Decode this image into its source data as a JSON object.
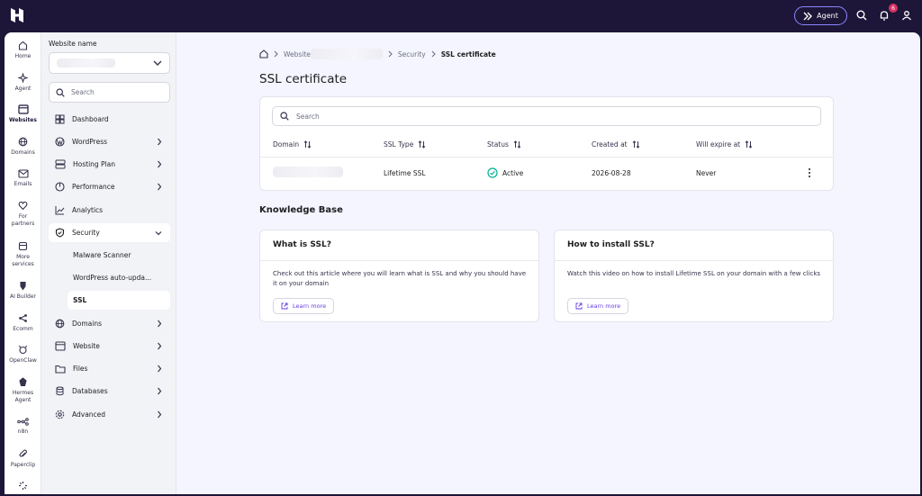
{
  "topbar": {
    "agent_label": "Agent",
    "notification_count": "6"
  },
  "rail": [
    {
      "label": "Home",
      "icon": "home-icon"
    },
    {
      "label": "Agent",
      "icon": "agent-icon"
    },
    {
      "label": "Websites",
      "icon": "websites-icon",
      "active": true
    },
    {
      "label": "Domains",
      "icon": "globe-icon"
    },
    {
      "label": "Emails",
      "icon": "mail-icon"
    },
    {
      "label": "For partners",
      "icon": "heart-icon"
    },
    {
      "label": "More services",
      "icon": "box-icon"
    },
    {
      "label": "AI Builder",
      "icon": "ai-builder-icon"
    },
    {
      "label": "Ecomm",
      "icon": "share-icon"
    },
    {
      "label": "OpenClaw",
      "icon": "claw-icon"
    },
    {
      "label": "Hermes Agent",
      "icon": "hermes-icon"
    },
    {
      "label": "n8n",
      "icon": "n8n-icon"
    },
    {
      "label": "Paperclip",
      "icon": "paperclip-icon"
    }
  ],
  "sidebar": {
    "title": "Website name",
    "search_placeholder": "Search",
    "items": [
      {
        "label": "Dashboard",
        "icon": "dashboard-icon"
      },
      {
        "label": "WordPress",
        "icon": "wordpress-icon"
      },
      {
        "label": "Hosting Plan",
        "icon": "server-icon"
      },
      {
        "label": "Performance",
        "icon": "gauge-icon"
      },
      {
        "label": "Analytics",
        "icon": "chart-line-icon"
      },
      {
        "label": "Security",
        "icon": "shield-icon"
      },
      {
        "label": "Domains",
        "icon": "globe-icon"
      },
      {
        "label": "Website",
        "icon": "browser-icon"
      },
      {
        "label": "Files",
        "icon": "folder-icon"
      },
      {
        "label": "Databases",
        "icon": "database-icon"
      },
      {
        "label": "Advanced",
        "icon": "gear-icon"
      }
    ],
    "security_sub": [
      {
        "label": "Malware Scanner"
      },
      {
        "label": "WordPress auto-upda..."
      },
      {
        "label": "SSL"
      }
    ]
  },
  "breadcrumb": {
    "websites": "Website",
    "security": "Security",
    "current": "SSL certificate"
  },
  "page_title": "SSL certificate",
  "table": {
    "search_placeholder": "Search",
    "columns": [
      "Domain",
      "SSL Type",
      "Status",
      "Created at",
      "Will expire at"
    ],
    "rows": [
      {
        "ssl_type": "Lifetime SSL",
        "status": "Active",
        "created_at": "2026-08-28",
        "expires": "Never"
      }
    ]
  },
  "knowledge_base": {
    "title": "Knowledge Base",
    "cards": [
      {
        "title": "What is SSL?",
        "text": "Check out this article where you will learn what is SSL and why you should have it on your domain",
        "button": "Learn more"
      },
      {
        "title": "How to install SSL?",
        "text": "Watch this video on how to install Lifetime SSL on your domain with a few clicks",
        "button": "Learn more"
      }
    ]
  },
  "colors": {
    "brand_dark": "#1d1638",
    "accent": "#673de6",
    "success": "#00b090",
    "badge": "#d63163"
  }
}
